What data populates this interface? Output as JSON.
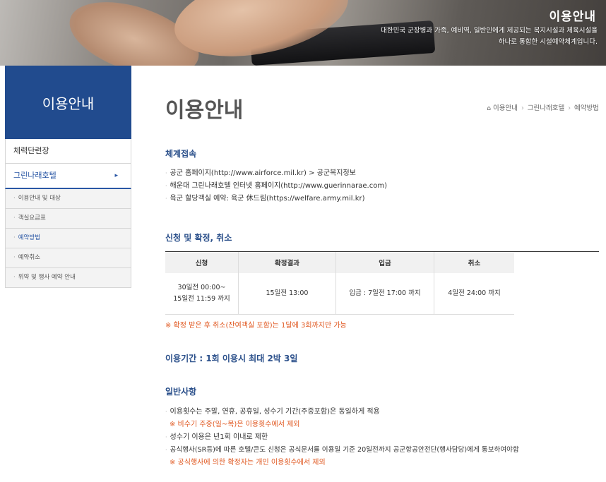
{
  "banner": {
    "title": "이용안내",
    "desc_line1": "대한민국 군장병과 가족, 예비역, 일반인에게 제공되는 복지시설과 체육시설을",
    "desc_line2": "하나로 통합한 시설예약체계입니다."
  },
  "sidebar": {
    "heading": "이용안내",
    "items": [
      {
        "label": "체력단련장"
      },
      {
        "label": "그린나래호텔",
        "arrow": "▸"
      }
    ],
    "subitems": [
      {
        "label": "이용안내 및 대상"
      },
      {
        "label": "객실요금표"
      },
      {
        "label": "예약방법"
      },
      {
        "label": "예약취소"
      },
      {
        "label": "위약 및 행사 예약 안내"
      }
    ]
  },
  "main": {
    "title": "이용안내",
    "breadcrumb": [
      "이용안내",
      "그린나래호텔",
      "예약방법"
    ],
    "sections": {
      "system": {
        "title": "체계접속",
        "items": [
          "공군 홈페이지(http://www.airforce.mil.kr) > 공군복지정보",
          "해운대 그린나래호텔 인터넷 홈페이지(http://www.guerinnarae.com)",
          "육군 할당객실 예약: 육군 休드림(https://welfare.army.mil.kr)"
        ]
      },
      "apply": {
        "title": "신청 및 확정, 취소",
        "table_headers": [
          "신청",
          "확정결과",
          "입금",
          "취소"
        ],
        "row": {
          "apply_line1": "30일전 00:00~",
          "apply_line2": "15일전 11:59 까지",
          "confirm": "15일전 13:00",
          "deposit": "입금 : 7일전 17:00 까지",
          "cancel": "4일전 24:00 까지"
        },
        "note": "※ 확정 받은 후 취소(잔여객실 포함)는 1달에 3회까지만 가능"
      },
      "period": {
        "title": "이용기간 : 1회 이용시 최대 2박 3일"
      },
      "general": {
        "title": "일반사항",
        "item1": "이용횟수는 주말, 연휴, 공휴일, 성수기 기간(주중포함)은 동일하게 적용",
        "note1": "※ 비수기 주중(일~목)은 이용횟수에서 제외",
        "item2": "성수기 이용은 년1회 이내로 제한",
        "item3": "공식행사(SR등)에 따른 호텔/콘도 신청은 공식문서를 이용일 기준 20일전까지 공군항공안전단(행사담당)에게 통보하여야함",
        "note3": "※ 공식행사에 의한 확정자는 개인 이용횟수에서 제외"
      }
    }
  },
  "colors": {
    "brand": "#214b8e",
    "accent": "#2a4f8a",
    "note": "#e0571f"
  },
  "icons": {
    "home": "home-icon",
    "chevron": "chevron-right-icon",
    "bullet": "bullet-icon"
  }
}
